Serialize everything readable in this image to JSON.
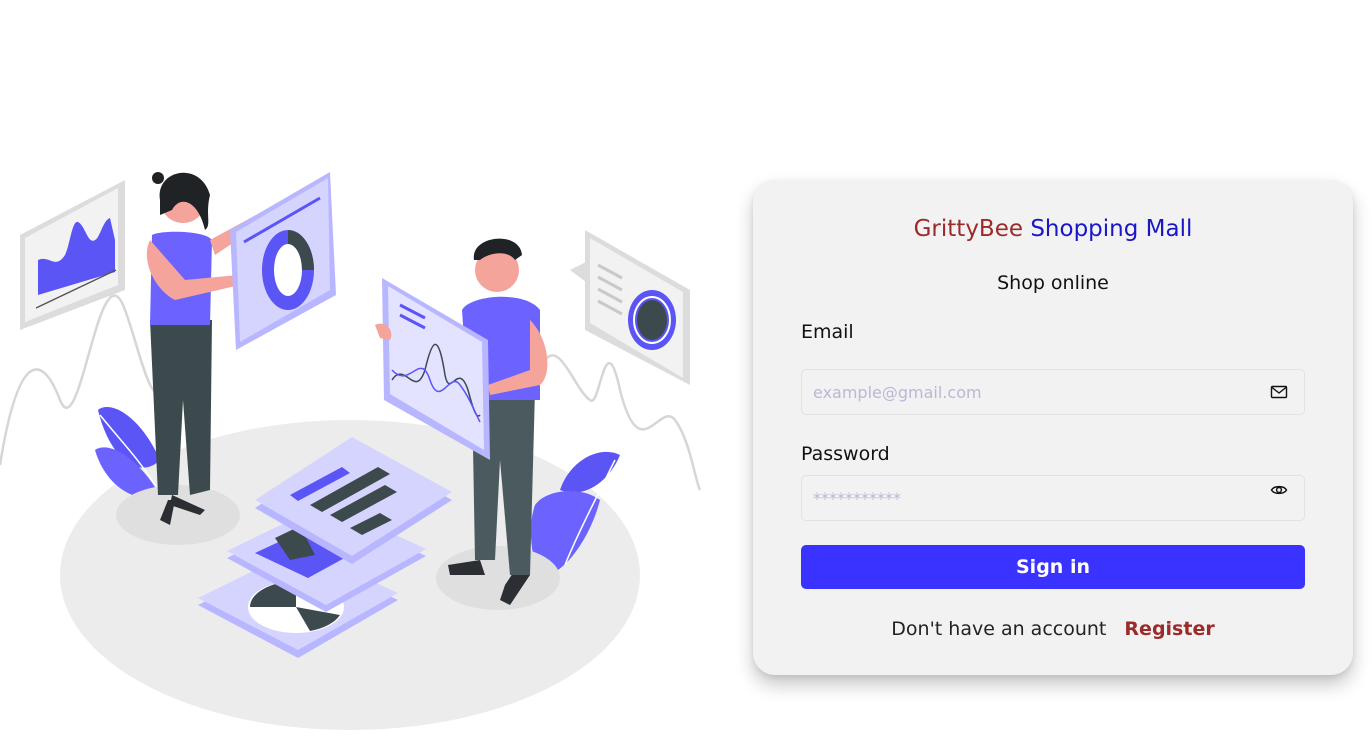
{
  "app": {
    "title_brand": "GrittyBee",
    "title_mall": "Shopping Mall",
    "subtitle": "Shop online"
  },
  "form": {
    "email_label": "Email",
    "email_placeholder": "example@gmail.com",
    "email_value": "",
    "password_label": "Password",
    "password_placeholder": "***********",
    "password_value": "",
    "signin_label": "Sign in",
    "no_account_text": "Don't have an account",
    "register_label": "Register"
  },
  "icons": {
    "email_field_icon": "mail-icon",
    "password_field_icon": "eye-icon"
  },
  "colors": {
    "brand_text": "#9b2a2a",
    "mall_text": "#1a17c9",
    "primary_button": "#3a33ff",
    "illustration_accent": "#6c63ff"
  }
}
